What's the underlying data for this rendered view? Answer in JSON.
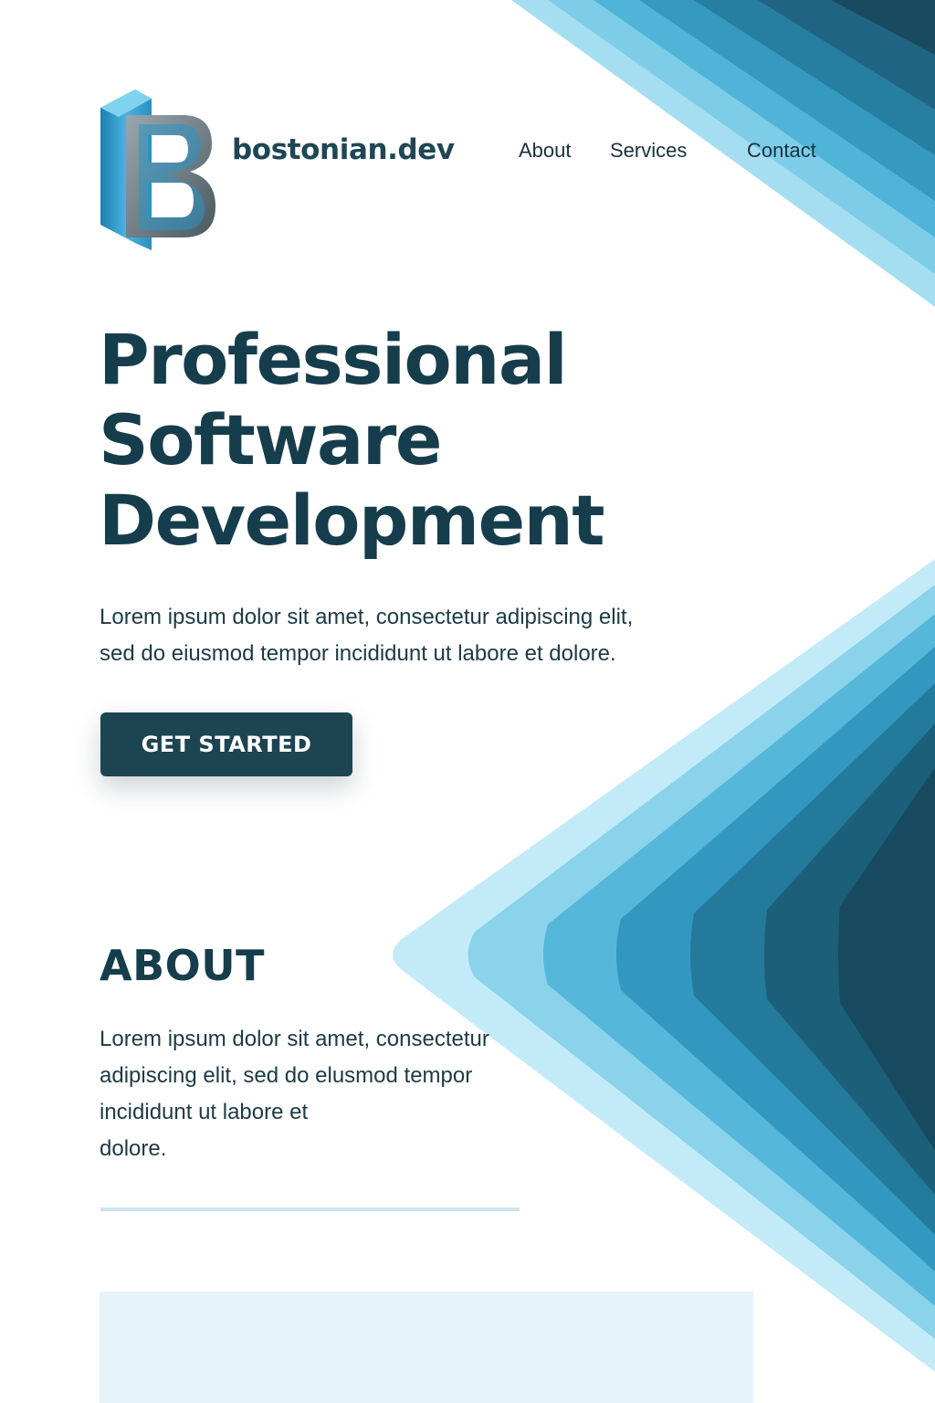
{
  "brand": {
    "name": "bostonian.dev",
    "logo_icon": "b-monogram-logo-icon"
  },
  "nav": {
    "items": [
      {
        "label": "About"
      },
      {
        "label": "Services"
      },
      {
        "label": "Contact"
      }
    ]
  },
  "hero": {
    "title_lines": [
      "Professional",
      "Software",
      "Development"
    ],
    "text_lines": [
      "Lorem ipsum dolor sit amet, consectetur adipiscing elit,",
      "sed do eiusmod tempor incididunt ut labore et dolore."
    ],
    "cta_label": "GET STARTED"
  },
  "about": {
    "title": "ABOUT",
    "text_lines": [
      "Lorem ipsum dolor sit amet, consectetur",
      "adipiscing elit, sed do elusmod tempor",
      "incididunt ut labore et",
      "dolore."
    ]
  },
  "colors": {
    "primary": "#1c4453",
    "heading": "#163d4c",
    "accent_light": "#7fd0ea",
    "accent_dark": "#164354",
    "panel": "#e6f3f9"
  }
}
